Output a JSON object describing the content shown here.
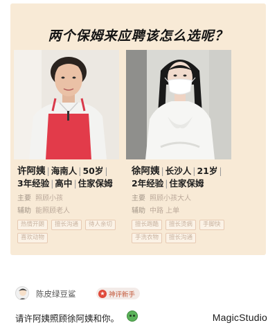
{
  "headline": "两个保姆来应聘该怎么选呢？",
  "candidates": [
    {
      "name": "许阿姨",
      "origin": "海南人",
      "age": "50岁",
      "experience": "3年经验",
      "education": "高中",
      "type": "住家保姆",
      "main_label": "主要",
      "main_value": "照顾小孩",
      "aux_label": "辅助",
      "aux_value": "能照顾老人",
      "tags": [
        "热情开朗",
        "擅长沟通",
        "待人亲切",
        "喜欢动物"
      ]
    },
    {
      "name": "徐阿姨",
      "origin": "长沙人",
      "age": "21岁",
      "experience": "2年经验",
      "type": "住家保姆",
      "main_label": "主要",
      "main_value": "照顾小孩大人",
      "aux_label": "辅助",
      "aux_value": "中路 上单",
      "tags": [
        "擅长跑酷",
        "擅长烫病",
        "手脚快",
        "手洗衣物",
        "擅长沟通"
      ]
    }
  ],
  "comment": {
    "username": "陈皮绿豆鲨",
    "badge": "神评新手",
    "text": "请许阿姨照顾徐阿姨和你。"
  },
  "watermark": "MagicStudio"
}
